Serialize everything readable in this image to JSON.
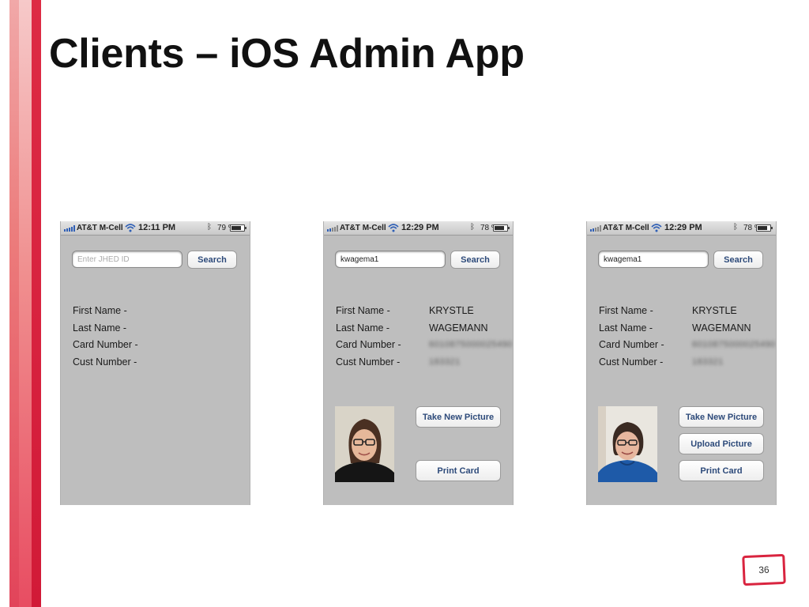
{
  "slide": {
    "title": "Clients – iOS Admin App",
    "page_number": "36"
  },
  "theme": {
    "accent": "#d9243f",
    "button_text": "#2d4a7a",
    "screen_bg": "#bebebe"
  },
  "labels": {
    "first_name": "First Name -",
    "last_name": "Last Name -",
    "card_number": "Card Number -",
    "cust_number": "Cust Number -"
  },
  "screens": [
    {
      "status": {
        "carrier": "AT&T M-Cell",
        "time": "12:11 PM",
        "battery": "79 %",
        "battery_level": 0.79
      },
      "search": {
        "placeholder": "Enter JHED ID",
        "value": "",
        "button": "Search"
      },
      "client": null,
      "buttons": []
    },
    {
      "status": {
        "carrier": "AT&T M-Cell",
        "time": "12:29 PM",
        "battery": "78 %",
        "battery_level": 0.78
      },
      "search": {
        "placeholder": "",
        "value": "kwagema1",
        "button": "Search"
      },
      "client": {
        "first_name": "KRYSTLE",
        "last_name": "WAGEMANN",
        "card_number": "6010875000025490",
        "cust_number": "183321"
      },
      "buttons": [
        "Take New Picture",
        "Print Card"
      ]
    },
    {
      "status": {
        "carrier": "AT&T M-Cell",
        "time": "12:29 PM",
        "battery": "78 %",
        "battery_level": 0.78
      },
      "search": {
        "placeholder": "",
        "value": "kwagema1",
        "button": "Search"
      },
      "client": {
        "first_name": "KRYSTLE",
        "last_name": "WAGEMANN",
        "card_number": "6010875000025490",
        "cust_number": "183321"
      },
      "buttons": [
        "Take New Picture",
        "Upload Picture",
        "Print Card"
      ]
    }
  ]
}
